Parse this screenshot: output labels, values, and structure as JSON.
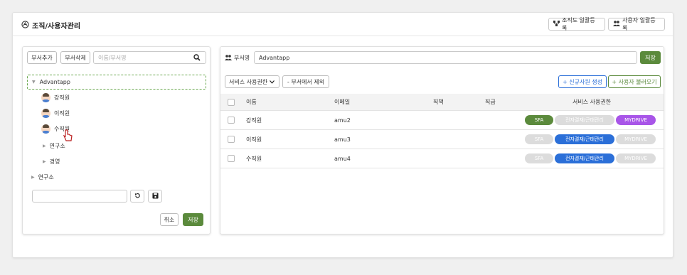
{
  "header": {
    "title": "조직/사용자관리",
    "org_upload_label": "조직도 일괄등록",
    "user_upload_label": "사용자 일괄등록"
  },
  "left_panel": {
    "add_dept_label": "부서추가",
    "delete_dept_label": "부서삭제",
    "search_placeholder": "이름/부서명",
    "tree": {
      "root": "Advantapp",
      "members": [
        "강직원",
        "이직원",
        "수직원"
      ],
      "sub_depts": [
        "연구소",
        "경영"
      ],
      "other_root": "연구소"
    },
    "edit_value": "",
    "cancel_label": "취소",
    "save_label": "저장"
  },
  "right_panel": {
    "dept_name_label": "부서명",
    "dept_name_value": "Advantapp",
    "save_label": "저장",
    "service_perm_dropdown": "서비스 사용권한",
    "remove_from_dept_label": "- 부서에서 제외",
    "new_employee_label": "+ 신규사원 생성",
    "import_user_label": "+ 사용자 불러오기",
    "columns": [
      "이름",
      "이메일",
      "직책",
      "직급",
      "서비스 사용권한"
    ],
    "rows": [
      {
        "name": "강직원",
        "email": "amu2",
        "position": "",
        "rank": "",
        "perms": {
          "sfa": true,
          "approval": false,
          "mydrive": true
        }
      },
      {
        "name": "이직원",
        "email": "amu3",
        "position": "",
        "rank": "",
        "perms": {
          "sfa": false,
          "approval": true,
          "mydrive": false
        }
      },
      {
        "name": "수직원",
        "email": "amu4",
        "position": "",
        "rank": "",
        "perms": {
          "sfa": false,
          "approval": true,
          "mydrive": false
        }
      }
    ],
    "service_labels": {
      "sfa": "SFA",
      "approval": "전자결재/근태관리",
      "mydrive": "MYDRIVE"
    }
  },
  "colors": {
    "green": "#5b8a3c",
    "blue": "#2b6fd8",
    "purple": "#a855e8",
    "disabled": "#dcdcdc"
  }
}
